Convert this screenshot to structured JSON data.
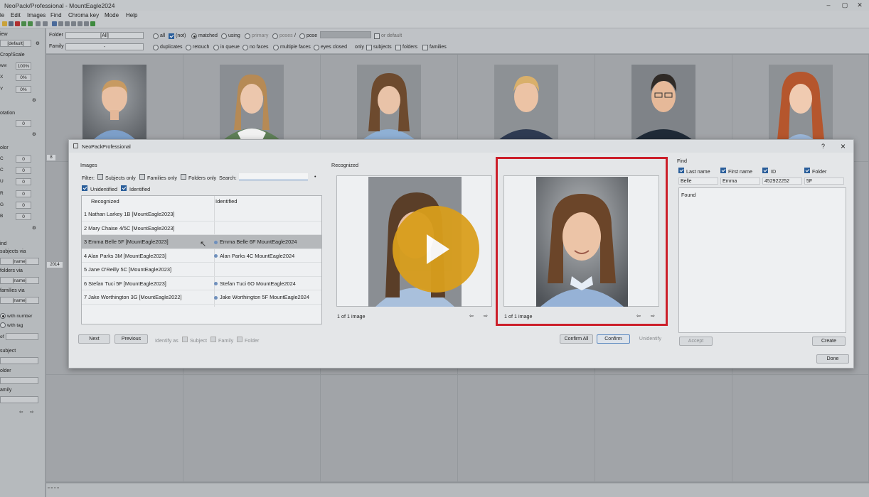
{
  "app": {
    "title": "NeoPack/Professional - MountEagle2024",
    "menu": [
      "File",
      "Edit",
      "Images",
      "Find",
      "Chroma key",
      "Mode",
      "Help"
    ],
    "menu_visible": [
      "le",
      "Edit",
      "Images",
      "Find",
      "Chroma key",
      "Mode",
      "Help"
    ]
  },
  "left": {
    "view_label": "iew",
    "view_value": "[default]",
    "crop_label": "Crop/Scale",
    "zoom_label": "ww",
    "zoom_value": "100%",
    "x_label": "X",
    "x_value": "0%",
    "y_label": "Y",
    "y_value": "0%",
    "rotation_label": "otation",
    "rot_value": "0",
    "color_label": "olor",
    "color_values": [
      "0",
      "0",
      "0",
      "0",
      "0",
      "0"
    ],
    "color_keys": [
      "C",
      "C",
      "U",
      "R",
      "G",
      "B"
    ],
    "find_label": "ind",
    "subjects_via": "subjects via",
    "folders_via": "folders via",
    "families_via": "families via",
    "name_field": "[name]",
    "with_number": "with number",
    "with_tag": "with tag",
    "of_label": "of",
    "subject_label": "subject",
    "folder_label": "older",
    "family_label": "amily",
    "year_tag": "2014"
  },
  "topbar": {
    "folder_label": "Folder",
    "folder_value": "[All]",
    "family_label": "Family",
    "family_value": "-",
    "row1": [
      "all",
      "(not)",
      "matched",
      "using",
      "primary",
      "poses",
      "/",
      "pose",
      "or default"
    ],
    "row2": [
      "duplicates",
      "retouch",
      "in queue",
      "no faces",
      "multiple faces",
      "eyes closed",
      "only",
      "subjects",
      "folders",
      "families"
    ]
  },
  "dialog": {
    "title": "NeoPackProfessional",
    "help": "?",
    "close": "×",
    "images_label": "Images",
    "filter_label": "Filter:",
    "subjects_only": "Subjects only",
    "families_only": "Families only",
    "folders_only": "Folders only",
    "search_label": "Search:",
    "unidentified": "Unidentified",
    "identified": "Identified",
    "col_recognized": "Recognized",
    "col_identified": "Identified",
    "rows": [
      {
        "rec": "1  Nathan Larkey 1B [MountEagle2023]",
        "ident": ""
      },
      {
        "rec": "2  Mary Chaise 4/5C [MountEagle2023]",
        "ident": ""
      },
      {
        "rec": "3  Emma Belle 5F [MountEagle2023]",
        "ident": "Emma Belle 6F MountEagle2024"
      },
      {
        "rec": "4  Alan Parks 3M [MountEagle2023]",
        "ident": "Alan Parks 4C MountEagle2024"
      },
      {
        "rec": "5  Jane O'Reilly 5C [MountEagle2023]",
        "ident": ""
      },
      {
        "rec": "6  Stefan Tuci 5F [MountEagle2023]",
        "ident": "Stefan Tuci 6O MountEagle2024"
      },
      {
        "rec": "7  Jake Worthington 3G [MountEagle2022]",
        "ident": "Jake Worthington 5F MountEagle2024"
      }
    ],
    "next": "Next",
    "previous": "Previous",
    "identify_as": "Identify as",
    "subject": "Subject",
    "family": "Family",
    "folder": "Folder",
    "recognized_label": "Recognized",
    "count_left": "1 of 1 image",
    "count_right": "1 of 1 image",
    "confirm_all": "Confirm All",
    "confirm": "Confirm",
    "unidentify": "Unidentify",
    "find_label": "Find",
    "last_name": "Last name",
    "first_name": "First name",
    "id": "ID",
    "folder_col": "Folder",
    "val_last": "Belle",
    "val_first": "Emma",
    "val_id": "452922252",
    "val_folder": "5F",
    "found_label": "Found",
    "accept": "Accept",
    "create": "Create",
    "done": "Done"
  },
  "colors": {
    "highlight_border": "#cc1f2a",
    "play_button": "#d99e1c",
    "checkbox_on": "#2a5e9a"
  }
}
